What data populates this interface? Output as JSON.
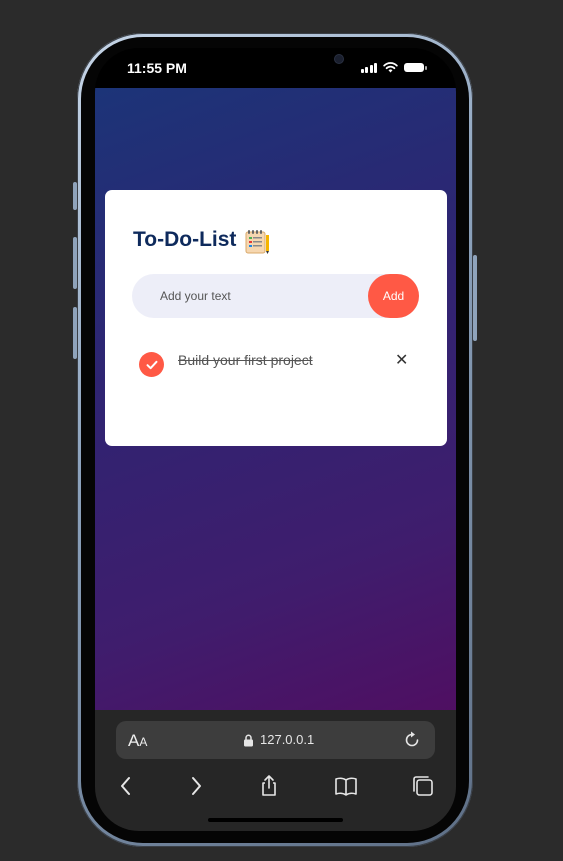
{
  "status_bar": {
    "time": "11:55 PM",
    "icons": [
      "signal-icon",
      "wifi-icon",
      "battery-icon"
    ]
  },
  "app": {
    "title": "To-Do-List",
    "title_icon": "notepad-icon",
    "input": {
      "placeholder": "Add your text",
      "value": ""
    },
    "add_button_label": "Add",
    "tasks": [
      {
        "text": "Build your first project",
        "completed": true
      }
    ],
    "colors": {
      "accent": "#ff5945",
      "title": "#0e2a5c",
      "input_background": "#edeef8",
      "gradient_start": "#1c3478",
      "gradient_end": "#4f0f62"
    }
  },
  "browser": {
    "text_size_label": "AA",
    "url": "127.0.0.1",
    "toolbar": [
      "back-icon",
      "forward-icon",
      "share-icon",
      "bookmarks-icon",
      "tabs-icon"
    ]
  }
}
